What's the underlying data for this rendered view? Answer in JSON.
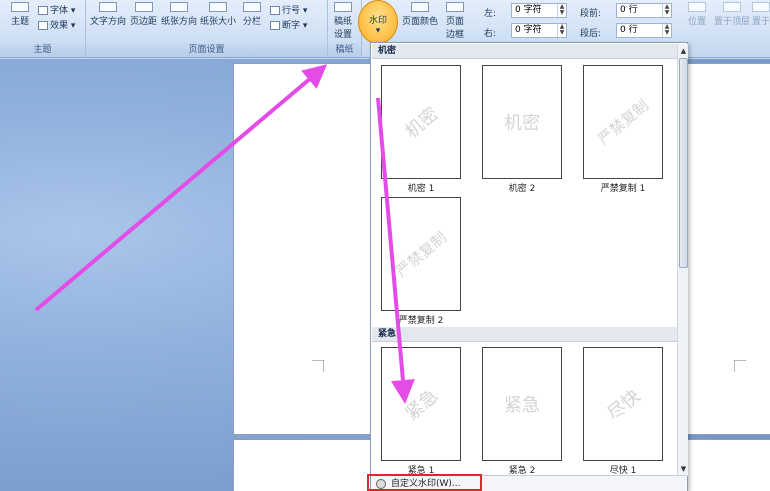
{
  "ribbon": {
    "themes": {
      "main_label": "主题",
      "font_label": "字体",
      "effect_label": "效果",
      "group_label": "主题"
    },
    "page_setup": {
      "text_direction": "文字方向",
      "margins": "页边距",
      "orientation": "纸张方向",
      "size": "纸张大小",
      "columns": "分栏",
      "line_numbers": "行号",
      "hyphenation": "断字",
      "group_label": "页面设置"
    },
    "manuscript": {
      "button_label_1": "稿纸",
      "button_label_2": "设置",
      "group_label": "稿纸"
    },
    "page_background": {
      "watermark": "水印",
      "page_color": "页面颜色",
      "page_border_1": "页面",
      "page_border_2": "边框"
    },
    "indent": {
      "left_label": "左:",
      "left_value": "0 字符",
      "right_label": "右:",
      "right_value": "0 字符"
    },
    "spacing": {
      "before_label": "段前:",
      "before_value": "0 行",
      "after_label": "段后:",
      "after_value": "0 行"
    },
    "arrange": {
      "position": "位置",
      "bring_front": "置于顶层",
      "send_back": "置于"
    }
  },
  "gallery": {
    "section_confidential": "机密",
    "section_urgent": "紧急",
    "items": [
      {
        "watermark": "机密",
        "caption": "机密 1",
        "style": "diag"
      },
      {
        "watermark": "机密",
        "caption": "机密 2",
        "style": "horiz"
      },
      {
        "watermark": "严禁复制",
        "caption": "严禁复制 1",
        "style": "diag"
      },
      {
        "watermark": "严禁复制",
        "caption": "严禁复制 2",
        "style": "diag"
      },
      {
        "watermark": "紧急",
        "caption": "紧急 1",
        "style": "diag"
      },
      {
        "watermark": "紧急",
        "caption": "紧急 2",
        "style": "horiz"
      },
      {
        "watermark": "尽快",
        "caption": "尽快 1",
        "style": "diag"
      }
    ],
    "custom_watermark": "自定义水印(W)..."
  },
  "colors": {
    "arrow": "#e44ce8",
    "highlight": "#e0262a",
    "watermark_button": "#ffc24a"
  }
}
